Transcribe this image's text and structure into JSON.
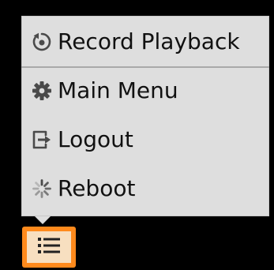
{
  "menu": {
    "items": [
      {
        "label": "Record Playback",
        "icon": "record-playback-icon"
      },
      {
        "label": "Main Menu",
        "icon": "gear-icon"
      },
      {
        "label": "Logout",
        "icon": "logout-icon"
      },
      {
        "label": "Reboot",
        "icon": "reboot-icon"
      }
    ]
  },
  "toolbar": {
    "menu_button_icon": "list-menu-icon"
  },
  "colors": {
    "background": "#000000",
    "menu_background": "#dedede",
    "divider": "#a9a9a9",
    "accent": "#ff8a1c",
    "button_inner": "#f7dfc0",
    "icon": "#4a4a4a",
    "text": "#111111"
  }
}
